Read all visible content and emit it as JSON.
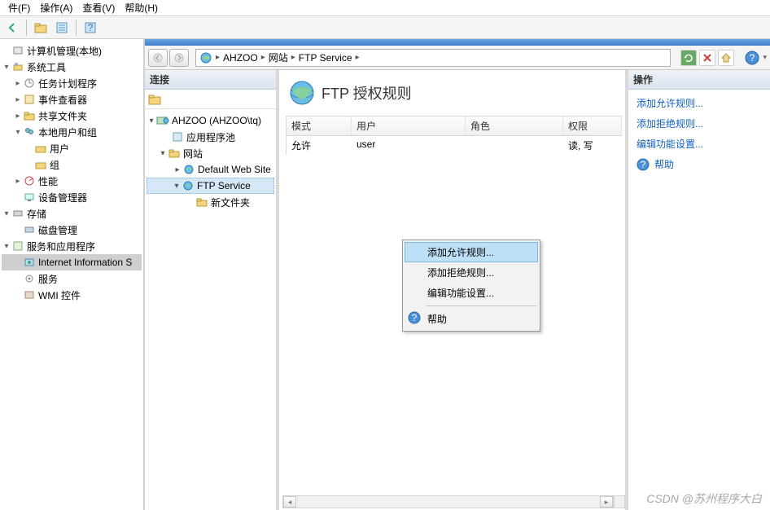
{
  "menus": {
    "file": "件(F)",
    "action": "操作(A)",
    "view": "查看(V)",
    "help": "帮助(H)"
  },
  "left_tree": {
    "root": "计算机管理(本地)",
    "sys_tools": "系统工具",
    "task_sched": "任务计划程序",
    "event_viewer": "事件查看器",
    "shared_folders": "共享文件夹",
    "local_users": "本地用户和组",
    "users": "用户",
    "groups": "组",
    "perf": "性能",
    "devmgr": "设备管理器",
    "storage": "存储",
    "diskmgmt": "磁盘管理",
    "services_apps": "服务和应用程序",
    "iis": "Internet Information S",
    "services": "服务",
    "wmi": "WMI 控件"
  },
  "breadcrumb": {
    "host": "AHZOO",
    "sites": "网站",
    "ftp": "FTP Service"
  },
  "conn": {
    "title": "连接",
    "server": "AHZOO (AHZOO\\tq)",
    "apppools": "应用程序池",
    "sites": "网站",
    "dws": "Default Web Site",
    "ftp": "FTP Service",
    "newfolder": "新文件夹"
  },
  "center": {
    "title": "FTP 授权规则",
    "cols": {
      "mode": "模式",
      "user": "用户",
      "role": "角色",
      "perm": "权限"
    },
    "rows": [
      {
        "mode": "允许",
        "user": "user",
        "role": "",
        "perm": "读, 写"
      }
    ]
  },
  "context_menu": {
    "add_allow": "添加允许规则...",
    "add_deny": "添加拒绝规则...",
    "edit_feat": "编辑功能设置...",
    "help": "帮助"
  },
  "actions": {
    "title": "操作",
    "add_allow": "添加允许规则...",
    "add_deny": "添加拒绝规则...",
    "edit_feat": "编辑功能设置...",
    "help": "帮助"
  },
  "watermark": "CSDN @苏州程序大白"
}
